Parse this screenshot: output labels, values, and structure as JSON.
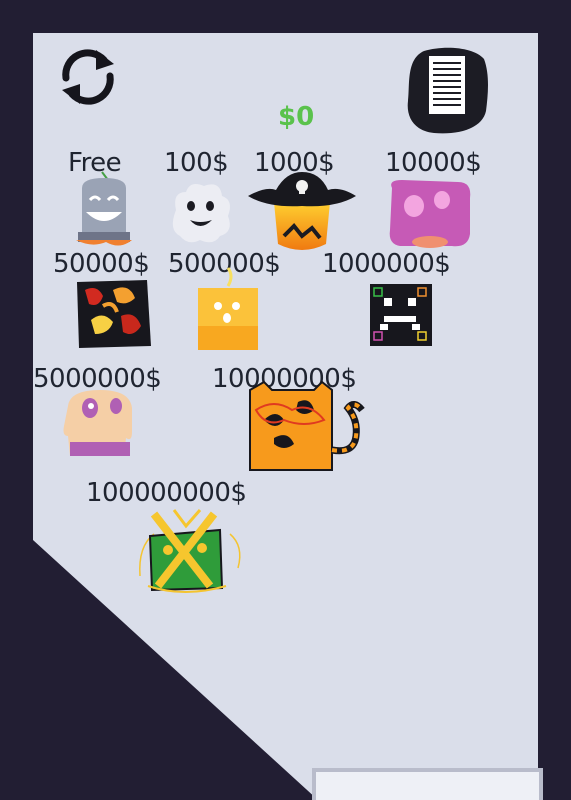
{
  "hud": {
    "money": "$0",
    "refresh_icon": "refresh-icon",
    "notes_icon": "document-icon"
  },
  "shop": {
    "items": [
      {
        "id": "tombstone",
        "price": "Free",
        "icon": "tombstone-character-icon"
      },
      {
        "id": "ghost",
        "price": "100$",
        "icon": "ghost-character-icon"
      },
      {
        "id": "pirate",
        "price": "1000$",
        "icon": "pirate-character-icon"
      },
      {
        "id": "pink-blob",
        "price": "10000$",
        "icon": "pink-blob-character-icon"
      },
      {
        "id": "lava",
        "price": "50000$",
        "icon": "lava-character-icon"
      },
      {
        "id": "candle",
        "price": "500000$",
        "icon": "candle-character-icon"
      },
      {
        "id": "pixel",
        "price": "1000000$",
        "icon": "pixel-character-icon"
      },
      {
        "id": "melting",
        "price": "5000000$",
        "icon": "melting-character-icon"
      },
      {
        "id": "cat",
        "price": "10000000$",
        "icon": "cat-character-icon"
      },
      {
        "id": "present",
        "price": "100000000$",
        "icon": "present-character-icon"
      }
    ]
  },
  "colors": {
    "background": "#221e33",
    "panel": "#dadeea",
    "money": "#5ac24c",
    "text": "#1f2430"
  }
}
